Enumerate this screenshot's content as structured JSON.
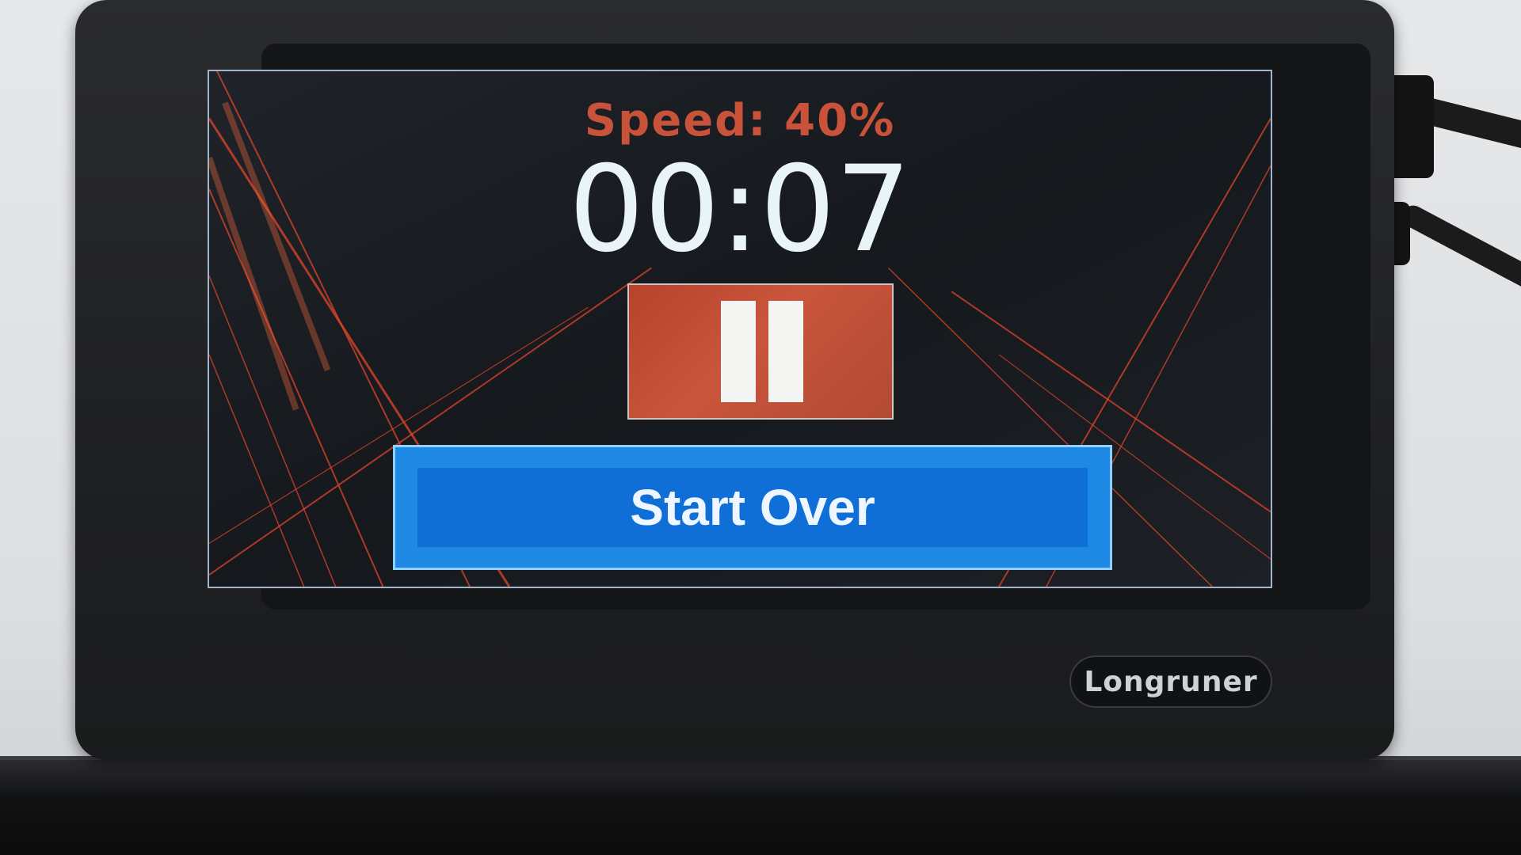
{
  "display": {
    "speed_text": "Speed: 40%",
    "timer_text": "00:07"
  },
  "controls": {
    "pause_icon": "pause-icon",
    "start_over_label": "Start Over"
  },
  "device": {
    "brand_label": "Longruner"
  },
  "colors": {
    "speed_text": "#c8523a",
    "timer_text": "#e9f4f6",
    "pause_button": "#c9553c",
    "start_button": "#1e88e5"
  }
}
